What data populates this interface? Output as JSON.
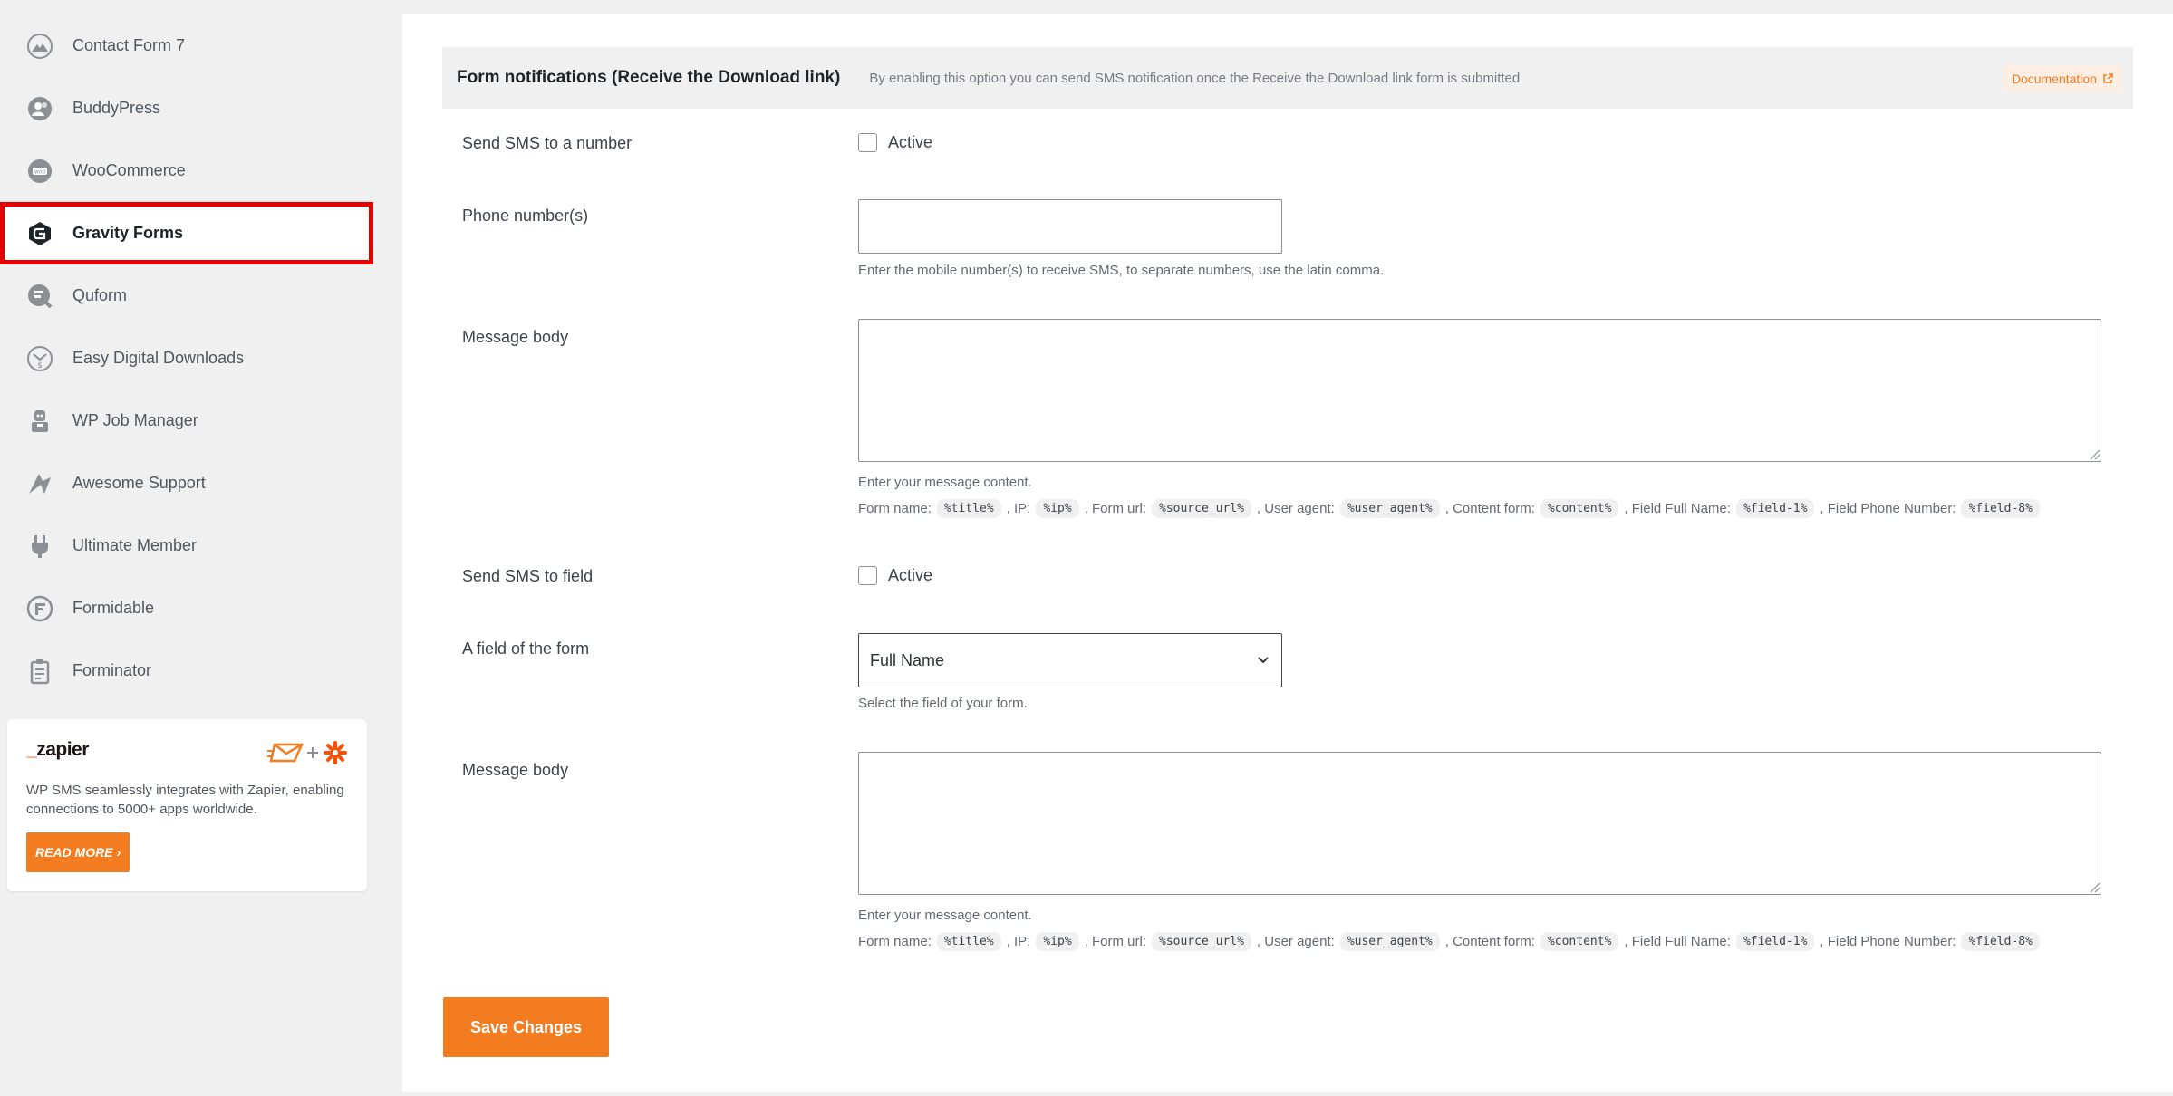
{
  "sidebar": {
    "items": [
      {
        "label": "Contact Form 7",
        "icon": "mountain-icon"
      },
      {
        "label": "BuddyPress",
        "icon": "buddypress-icon"
      },
      {
        "label": "WooCommerce",
        "icon": "woocommerce-icon"
      },
      {
        "label": "Gravity Forms",
        "icon": "gravity-forms-icon",
        "active": true
      },
      {
        "label": "Quform",
        "icon": "quform-icon"
      },
      {
        "label": "Easy Digital Downloads",
        "icon": "edd-icon"
      },
      {
        "label": "WP Job Manager",
        "icon": "job-manager-icon"
      },
      {
        "label": "Awesome Support",
        "icon": "awesome-support-icon"
      },
      {
        "label": "Ultimate Member",
        "icon": "plug-icon"
      },
      {
        "label": "Formidable",
        "icon": "formidable-icon"
      },
      {
        "label": "Forminator",
        "icon": "clipboard-icon"
      }
    ],
    "zapier": {
      "logo_prefix": "_",
      "logo_text": "zapier",
      "text": "WP SMS seamlessly integrates with Zapier, enabling connections to 5000+ apps worldwide.",
      "button": "READ MORE ›"
    }
  },
  "main": {
    "section": {
      "title": "Form notifications (Receive the Download link)",
      "description": "By enabling this option you can send SMS notification once the Receive the Download link form is submitted",
      "doc_link": "Documentation"
    },
    "send_to_number": {
      "label": "Send SMS to a number",
      "checkbox": "Active"
    },
    "phone_numbers": {
      "label": "Phone number(s)",
      "value": "",
      "help": "Enter the mobile number(s) to receive SMS, to separate numbers, use the latin comma."
    },
    "message_body_1": {
      "label": "Message body",
      "value": "",
      "help": "Enter your message content."
    },
    "send_to_field": {
      "label": "Send SMS to field",
      "checkbox": "Active"
    },
    "form_field": {
      "label": "A field of the form",
      "selected": "Full Name",
      "help": "Select the field of your form."
    },
    "message_body_2": {
      "label": "Message body",
      "value": "",
      "help": "Enter your message content."
    },
    "vars": {
      "form_name_label": "Form name:",
      "form_name_code": "%title%",
      "ip_label": ", IP:",
      "ip_code": "%ip%",
      "form_url_label": ", Form url:",
      "form_url_code": "%source_url%",
      "user_agent_label": ", User agent:",
      "user_agent_code": "%user_agent%",
      "content_label": ", Content form:",
      "content_code": "%content%",
      "full_name_label": ", Field Full Name:",
      "full_name_code": "%field-1%",
      "phone_label": ", Field Phone Number:",
      "phone_code": "%field-8%"
    },
    "save_button": "Save Changes"
  },
  "colors": {
    "accent": "#f47c20",
    "highlight": "#e60000",
    "background": "#f0f0f1"
  }
}
